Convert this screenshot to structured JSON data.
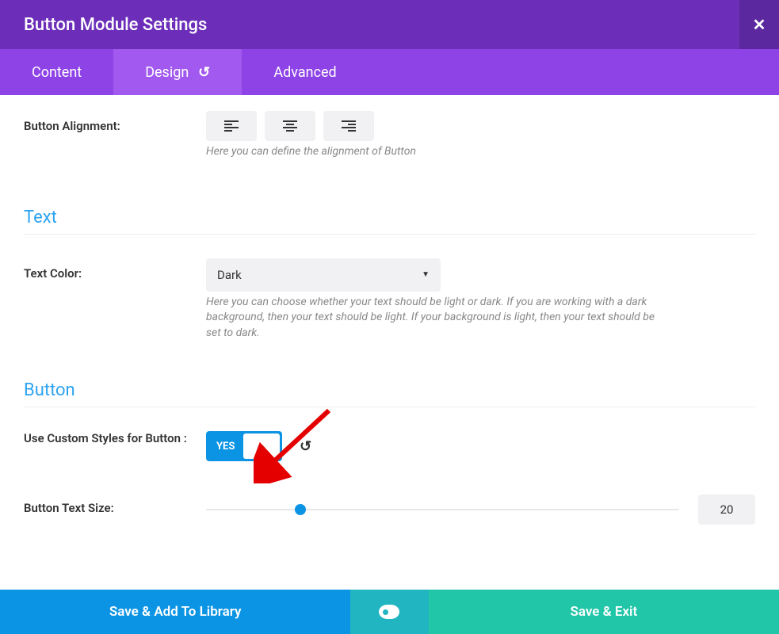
{
  "header": {
    "title": "Button Module Settings"
  },
  "tabs": {
    "content": "Content",
    "design": "Design",
    "advanced": "Advanced"
  },
  "alignment": {
    "label": "Button Alignment:",
    "help": "Here you can define the alignment of Button"
  },
  "sections": {
    "text": "Text",
    "button": "Button"
  },
  "text_color": {
    "label": "Text Color:",
    "value": "Dark",
    "help": "Here you can choose whether your text should be light or dark. If you are working with a dark background, then your text should be light. If your background is light, then your text should be set to dark."
  },
  "custom_styles": {
    "label": "Use Custom Styles for Button :",
    "toggle": "YES"
  },
  "text_size": {
    "label": "Button Text Size:",
    "value": "20"
  },
  "footer": {
    "save_lib": "Save & Add To Library",
    "save_exit": "Save & Exit"
  }
}
